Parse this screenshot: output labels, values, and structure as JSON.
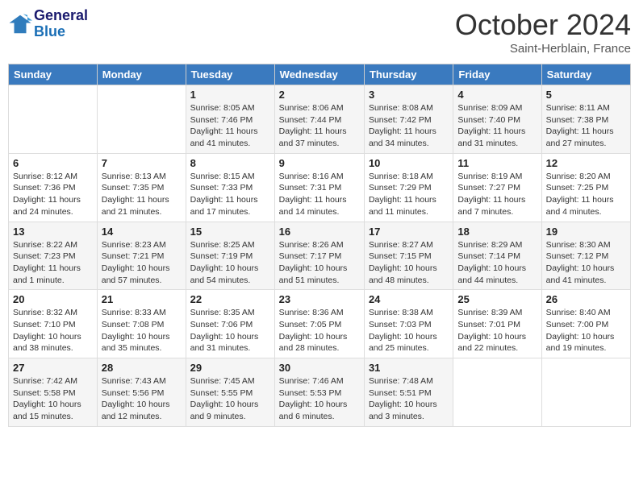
{
  "logo": {
    "line1": "General",
    "line2": "Blue"
  },
  "title": "October 2024",
  "location": "Saint-Herblain, France",
  "weekdays": [
    "Sunday",
    "Monday",
    "Tuesday",
    "Wednesday",
    "Thursday",
    "Friday",
    "Saturday"
  ],
  "weeks": [
    [
      null,
      null,
      {
        "day": "1",
        "sunrise": "8:05 AM",
        "sunset": "7:46 PM",
        "daylight": "11 hours and 41 minutes."
      },
      {
        "day": "2",
        "sunrise": "8:06 AM",
        "sunset": "7:44 PM",
        "daylight": "11 hours and 37 minutes."
      },
      {
        "day": "3",
        "sunrise": "8:08 AM",
        "sunset": "7:42 PM",
        "daylight": "11 hours and 34 minutes."
      },
      {
        "day": "4",
        "sunrise": "8:09 AM",
        "sunset": "7:40 PM",
        "daylight": "11 hours and 31 minutes."
      },
      {
        "day": "5",
        "sunrise": "8:11 AM",
        "sunset": "7:38 PM",
        "daylight": "11 hours and 27 minutes."
      }
    ],
    [
      {
        "day": "6",
        "sunrise": "8:12 AM",
        "sunset": "7:36 PM",
        "daylight": "11 hours and 24 minutes."
      },
      {
        "day": "7",
        "sunrise": "8:13 AM",
        "sunset": "7:35 PM",
        "daylight": "11 hours and 21 minutes."
      },
      {
        "day": "8",
        "sunrise": "8:15 AM",
        "sunset": "7:33 PM",
        "daylight": "11 hours and 17 minutes."
      },
      {
        "day": "9",
        "sunrise": "8:16 AM",
        "sunset": "7:31 PM",
        "daylight": "11 hours and 14 minutes."
      },
      {
        "day": "10",
        "sunrise": "8:18 AM",
        "sunset": "7:29 PM",
        "daylight": "11 hours and 11 minutes."
      },
      {
        "day": "11",
        "sunrise": "8:19 AM",
        "sunset": "7:27 PM",
        "daylight": "11 hours and 7 minutes."
      },
      {
        "day": "12",
        "sunrise": "8:20 AM",
        "sunset": "7:25 PM",
        "daylight": "11 hours and 4 minutes."
      }
    ],
    [
      {
        "day": "13",
        "sunrise": "8:22 AM",
        "sunset": "7:23 PM",
        "daylight": "11 hours and 1 minute."
      },
      {
        "day": "14",
        "sunrise": "8:23 AM",
        "sunset": "7:21 PM",
        "daylight": "10 hours and 57 minutes."
      },
      {
        "day": "15",
        "sunrise": "8:25 AM",
        "sunset": "7:19 PM",
        "daylight": "10 hours and 54 minutes."
      },
      {
        "day": "16",
        "sunrise": "8:26 AM",
        "sunset": "7:17 PM",
        "daylight": "10 hours and 51 minutes."
      },
      {
        "day": "17",
        "sunrise": "8:27 AM",
        "sunset": "7:15 PM",
        "daylight": "10 hours and 48 minutes."
      },
      {
        "day": "18",
        "sunrise": "8:29 AM",
        "sunset": "7:14 PM",
        "daylight": "10 hours and 44 minutes."
      },
      {
        "day": "19",
        "sunrise": "8:30 AM",
        "sunset": "7:12 PM",
        "daylight": "10 hours and 41 minutes."
      }
    ],
    [
      {
        "day": "20",
        "sunrise": "8:32 AM",
        "sunset": "7:10 PM",
        "daylight": "10 hours and 38 minutes."
      },
      {
        "day": "21",
        "sunrise": "8:33 AM",
        "sunset": "7:08 PM",
        "daylight": "10 hours and 35 minutes."
      },
      {
        "day": "22",
        "sunrise": "8:35 AM",
        "sunset": "7:06 PM",
        "daylight": "10 hours and 31 minutes."
      },
      {
        "day": "23",
        "sunrise": "8:36 AM",
        "sunset": "7:05 PM",
        "daylight": "10 hours and 28 minutes."
      },
      {
        "day": "24",
        "sunrise": "8:38 AM",
        "sunset": "7:03 PM",
        "daylight": "10 hours and 25 minutes."
      },
      {
        "day": "25",
        "sunrise": "8:39 AM",
        "sunset": "7:01 PM",
        "daylight": "10 hours and 22 minutes."
      },
      {
        "day": "26",
        "sunrise": "8:40 AM",
        "sunset": "7:00 PM",
        "daylight": "10 hours and 19 minutes."
      }
    ],
    [
      {
        "day": "27",
        "sunrise": "7:42 AM",
        "sunset": "5:58 PM",
        "daylight": "10 hours and 15 minutes."
      },
      {
        "day": "28",
        "sunrise": "7:43 AM",
        "sunset": "5:56 PM",
        "daylight": "10 hours and 12 minutes."
      },
      {
        "day": "29",
        "sunrise": "7:45 AM",
        "sunset": "5:55 PM",
        "daylight": "10 hours and 9 minutes."
      },
      {
        "day": "30",
        "sunrise": "7:46 AM",
        "sunset": "5:53 PM",
        "daylight": "10 hours and 6 minutes."
      },
      {
        "day": "31",
        "sunrise": "7:48 AM",
        "sunset": "5:51 PM",
        "daylight": "10 hours and 3 minutes."
      },
      null,
      null
    ]
  ],
  "labels": {
    "sunrise": "Sunrise:",
    "sunset": "Sunset:",
    "daylight": "Daylight:"
  }
}
